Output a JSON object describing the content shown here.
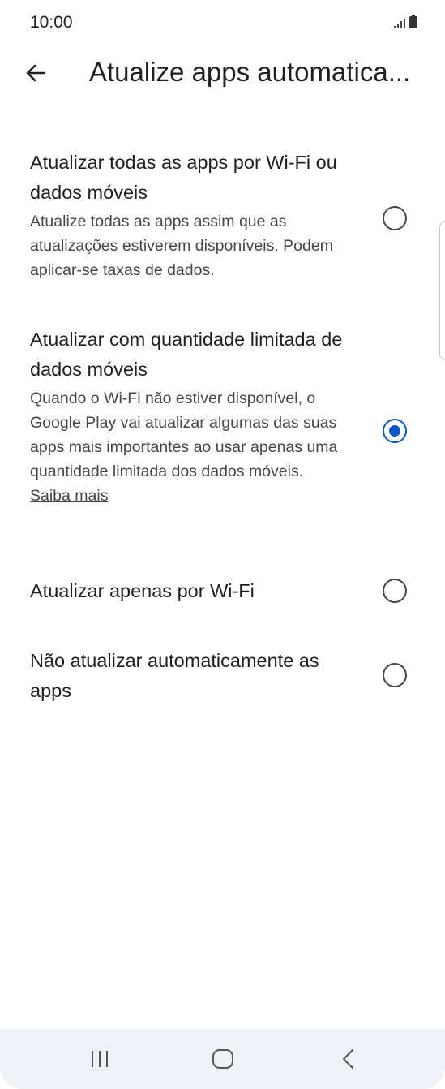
{
  "status_bar": {
    "time": "10:00"
  },
  "header": {
    "title": "Atualize apps automatica..."
  },
  "options": [
    {
      "title": "Atualizar todas as apps por Wi-Fi ou dados móveis",
      "description": "Atualize todas as apps assim que as atualizações estiverem disponíveis. Podem aplicar-se taxas de dados.",
      "selected": false
    },
    {
      "title": "Atualizar com quantidade limitada de dados móveis",
      "description": "Quando o Wi-Fi não estiver disponível, o Google Play vai atualizar algumas das suas apps mais importantes ao usar apenas uma quantidade limitada dos dados móveis.",
      "link": "Saiba mais",
      "selected": true
    },
    {
      "title": "Atualizar apenas por Wi-Fi",
      "selected": false
    },
    {
      "title": "Não atualizar automaticamente as apps",
      "selected": false
    }
  ],
  "nav_bar": {
    "buttons": [
      "recent-apps",
      "home",
      "back"
    ]
  },
  "colors": {
    "accent": "#0b57d0",
    "radio_unchecked": "#444746",
    "nav_background": "#eef1f5"
  }
}
